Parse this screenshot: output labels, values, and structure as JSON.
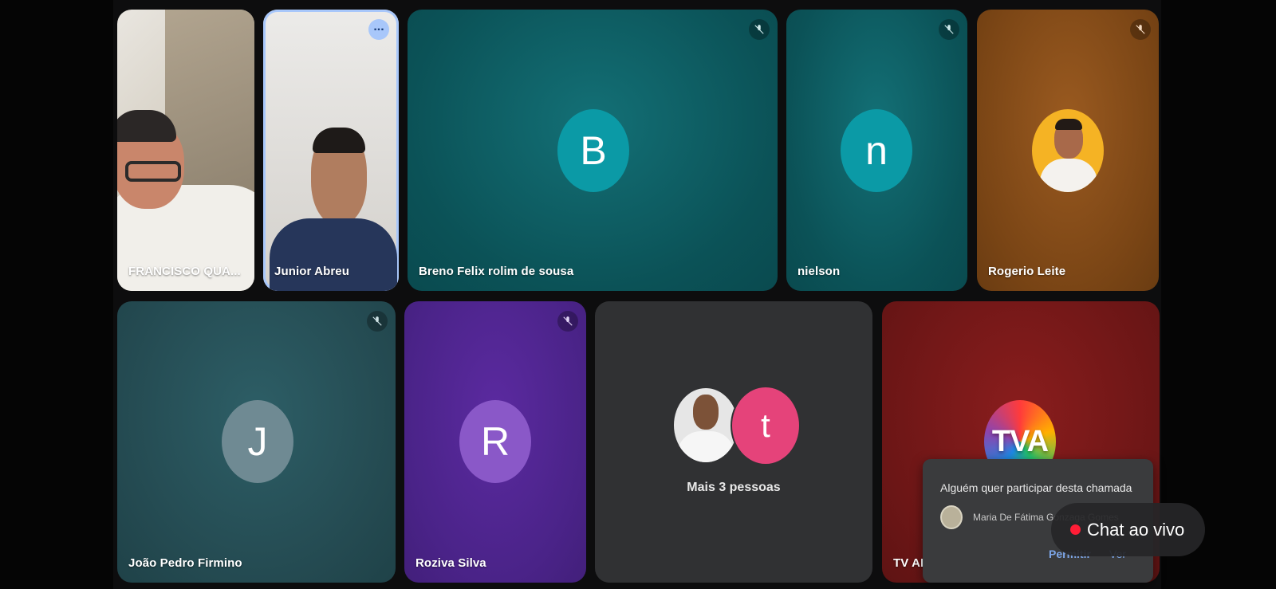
{
  "participants": {
    "francisco": {
      "name": "FRANCISCO QUA..."
    },
    "junior": {
      "name": "Junior Abreu",
      "menu_icon": "more-horiz-icon"
    },
    "breno": {
      "name": "Breno Felix rolim de sousa",
      "initial": "B",
      "color": "#0b9aa6",
      "muted": true
    },
    "nielson": {
      "name": "nielson",
      "initial": "n",
      "color": "#0b9aa6",
      "muted": true
    },
    "rogerio": {
      "name": "Rogerio Leite",
      "muted": true
    },
    "joao": {
      "name": "João Pedro Firmino",
      "initial": "J",
      "color": "#6f8a93",
      "muted": true
    },
    "roziva": {
      "name": "Roziva Silva",
      "initial": "R",
      "color": "#8a58c8",
      "muted": true
    },
    "more": {
      "label": "Mais 3 pessoas",
      "initial": "t",
      "color": "#e5437a"
    },
    "tva": {
      "name": "TV AL",
      "logo_text": "TVA"
    }
  },
  "join_request": {
    "title": "Alguém quer participar desta chamada",
    "user": "Maria De Fátima Gonzaga Gomes",
    "allow_label": "Permitir",
    "view_label": "Ver"
  },
  "live_chat": {
    "label": "Chat ao vivo",
    "dot_color": "#ff1d36"
  }
}
